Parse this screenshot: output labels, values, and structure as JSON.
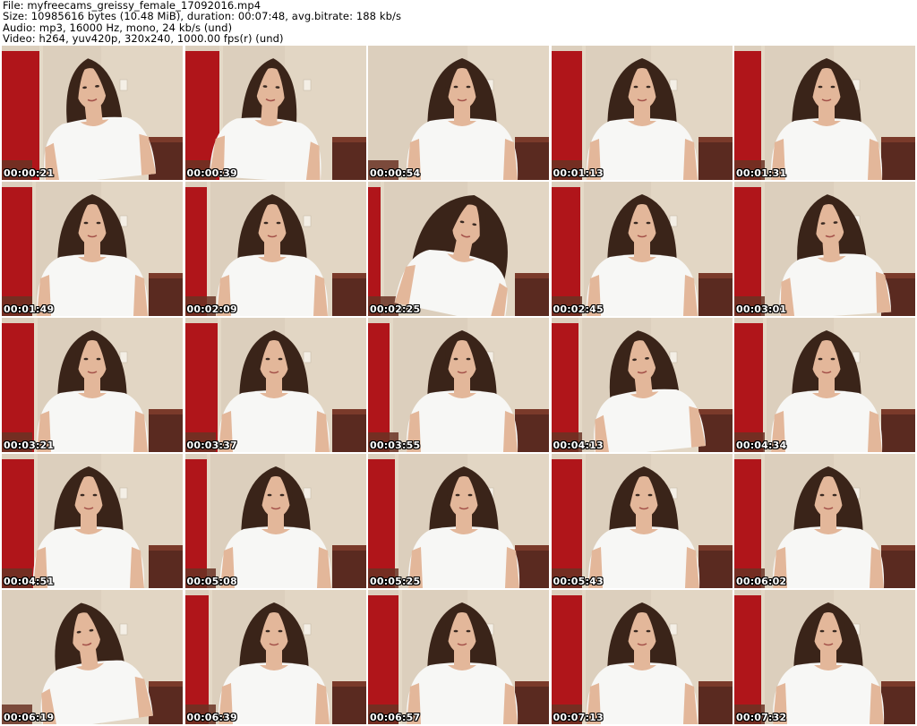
{
  "header": {
    "file_line": "File: myfreecams_greissy_female_17092016.mp4",
    "size_line": "Size: 10985616 bytes (10.48 MiB), duration: 00:07:48, avg.bitrate: 188 kb/s",
    "audio_line": "Audio: mp3, 16000 Hz, mono, 24 kb/s (und)",
    "video_line": "Video: h264, yuv420p, 320x240, 1000.00 fps(r) (und)"
  },
  "thumbnails": [
    {
      "timestamp": "00:00:21"
    },
    {
      "timestamp": "00:00:39"
    },
    {
      "timestamp": "00:00:54"
    },
    {
      "timestamp": "00:01:13"
    },
    {
      "timestamp": "00:01:31"
    },
    {
      "timestamp": "00:01:49"
    },
    {
      "timestamp": "00:02:09"
    },
    {
      "timestamp": "00:02:25"
    },
    {
      "timestamp": "00:02:45"
    },
    {
      "timestamp": "00:03:01"
    },
    {
      "timestamp": "00:03:21"
    },
    {
      "timestamp": "00:03:37"
    },
    {
      "timestamp": "00:03:55"
    },
    {
      "timestamp": "00:04:13"
    },
    {
      "timestamp": "00:04:34"
    },
    {
      "timestamp": "00:04:51"
    },
    {
      "timestamp": "00:05:08"
    },
    {
      "timestamp": "00:05:25"
    },
    {
      "timestamp": "00:05:43"
    },
    {
      "timestamp": "00:06:02"
    },
    {
      "timestamp": "00:06:19"
    },
    {
      "timestamp": "00:06:39"
    },
    {
      "timestamp": "00:06:57"
    },
    {
      "timestamp": "00:07:13"
    },
    {
      "timestamp": "00:07:32"
    }
  ],
  "colors": {
    "wall": "#dccfbd",
    "door": "#b0151a",
    "shirt": "#f7f7f5",
    "hair": "#3a2419",
    "skin": "#e3b79a",
    "furniture": "#5a2a20"
  }
}
